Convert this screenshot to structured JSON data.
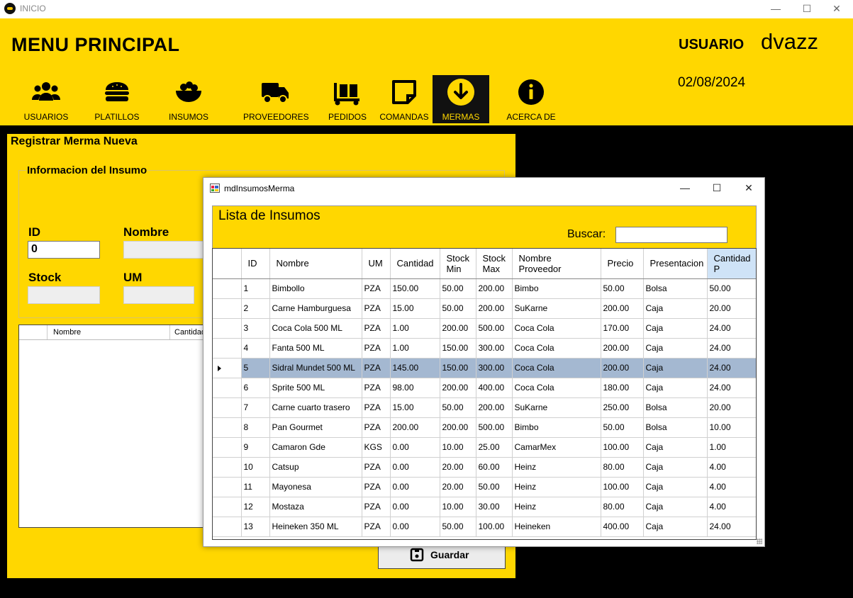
{
  "window": {
    "title": "INICIO",
    "controls": {
      "minimize": "—",
      "maximize": "☐",
      "close": "✕"
    }
  },
  "header": {
    "title": "MENU PRINCIPAL",
    "user_label": "USUARIO",
    "user_name": "dvazz",
    "date": "02/08/2024",
    "accent_color": "#ffd700"
  },
  "nav": [
    {
      "label": "USUARIOS",
      "icon": "users-icon"
    },
    {
      "label": "PLATILLOS",
      "icon": "burger-icon"
    },
    {
      "label": "INSUMOS",
      "icon": "food-bowl-icon"
    },
    {
      "label": "PROVEEDORES",
      "icon": "truck-icon"
    },
    {
      "label": "PEDIDOS",
      "icon": "dolly-icon"
    },
    {
      "label": "COMANDAS",
      "icon": "note-icon"
    },
    {
      "label": "MERMAS",
      "icon": "arrow-down-circle-icon",
      "active": true
    },
    {
      "label": "ACERCA DE",
      "icon": "info-circle-icon"
    }
  ],
  "form": {
    "title": "Registrar Merma Nueva",
    "group_title": "Informacion del Insumo",
    "id_label": "ID",
    "id_value": "0",
    "nombre_label": "Nombre",
    "stock_label": "Stock",
    "um_label": "UM",
    "grid_headers": [
      "Nombre",
      "Cantidad"
    ],
    "save_label": "Guardar"
  },
  "dialog": {
    "title": "mdInsumosMerma",
    "controls": {
      "minimize": "—",
      "maximize": "☐",
      "close": "✕"
    },
    "panel_title": "Lista de Insumos",
    "search_label": "Buscar:",
    "search_value": "",
    "columns": [
      "ID",
      "Nombre",
      "UM",
      "Cantidad",
      "Stock Min",
      "Stock Max",
      "Nombre Proveedor",
      "Precio",
      "Presentacion",
      "Cantidad P"
    ],
    "selected_row": 4,
    "rows": [
      [
        "1",
        "Bimbollo",
        "PZA",
        "150.00",
        "50.00",
        "200.00",
        "Bimbo",
        "50.00",
        "Bolsa",
        "50.00"
      ],
      [
        "2",
        "Carne Hamburguesa",
        "PZA",
        "15.00",
        "50.00",
        "200.00",
        "SuKarne",
        "200.00",
        "Caja",
        "20.00"
      ],
      [
        "3",
        "Coca Cola 500 ML",
        "PZA",
        "1.00",
        "200.00",
        "500.00",
        "Coca Cola",
        "170.00",
        "Caja",
        "24.00"
      ],
      [
        "4",
        "Fanta 500 ML",
        "PZA",
        "1.00",
        "150.00",
        "300.00",
        "Coca Cola",
        "200.00",
        "Caja",
        "24.00"
      ],
      [
        "5",
        "Sidral Mundet 500 ML",
        "PZA",
        "145.00",
        "150.00",
        "300.00",
        "Coca Cola",
        "200.00",
        "Caja",
        "24.00"
      ],
      [
        "6",
        "Sprite 500 ML",
        "PZA",
        "98.00",
        "200.00",
        "400.00",
        "Coca Cola",
        "180.00",
        "Caja",
        "24.00"
      ],
      [
        "7",
        "Carne cuarto trasero",
        "PZA",
        "15.00",
        "50.00",
        "200.00",
        "SuKarne",
        "250.00",
        "Bolsa",
        "20.00"
      ],
      [
        "8",
        "Pan Gourmet",
        "PZA",
        "200.00",
        "200.00",
        "500.00",
        "Bimbo",
        "50.00",
        "Bolsa",
        "10.00"
      ],
      [
        "9",
        "Camaron Gde",
        "KGS",
        "0.00",
        "10.00",
        "25.00",
        "CamarMex",
        "100.00",
        "Caja",
        "1.00"
      ],
      [
        "10",
        "Catsup",
        "PZA",
        "0.00",
        "20.00",
        "60.00",
        "Heinz",
        "80.00",
        "Caja",
        "4.00"
      ],
      [
        "11",
        "Mayonesa",
        "PZA",
        "0.00",
        "20.00",
        "50.00",
        "Heinz",
        "100.00",
        "Caja",
        "4.00"
      ],
      [
        "12",
        "Mostaza",
        "PZA",
        "0.00",
        "10.00",
        "30.00",
        "Heinz",
        "80.00",
        "Caja",
        "4.00"
      ],
      [
        "13",
        "Heineken 350 ML",
        "PZA",
        "0.00",
        "50.00",
        "100.00",
        "Heineken",
        "400.00",
        "Caja",
        "24.00"
      ]
    ]
  }
}
